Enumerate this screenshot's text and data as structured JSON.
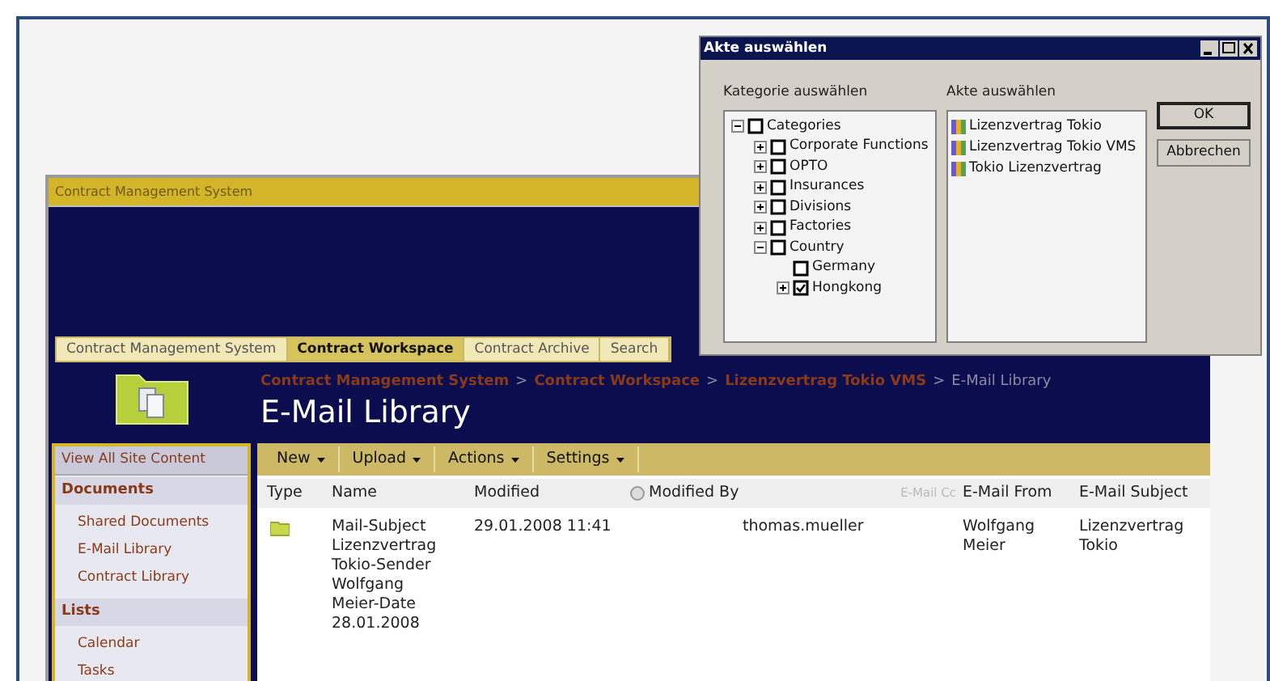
{
  "window": {
    "title": "Contract Management System"
  },
  "top_nav": [
    {
      "label": "Contract Management System",
      "selected": false
    },
    {
      "label": "Contract Workspace",
      "selected": true
    },
    {
      "label": "Contract Archive",
      "selected": false
    },
    {
      "label": "Search",
      "selected": false
    }
  ],
  "breadcrumb": {
    "separator": ">",
    "items": [
      "Contract Management System",
      "Contract Workspace",
      "Lizenzvertrag Tokio VMS",
      "E-Mail Library"
    ]
  },
  "page_title": "E-Mail Library",
  "quick_launch": {
    "view_all": "View All Site Content",
    "sections": [
      {
        "heading": "Documents",
        "items": [
          "Shared Documents",
          "E-Mail Library",
          "Contract Library"
        ]
      },
      {
        "heading": "Lists",
        "items": [
          "Calendar",
          "Tasks"
        ]
      }
    ]
  },
  "toolbar": [
    {
      "label": "New"
    },
    {
      "label": "Upload"
    },
    {
      "label": "Actions"
    },
    {
      "label": "Settings"
    }
  ],
  "table": {
    "columns": [
      {
        "label": "Type"
      },
      {
        "label": "Name"
      },
      {
        "label": "Modified"
      },
      {
        "label": "Modified By",
        "kind": "presence"
      },
      {
        "label": "E-Mail Cc",
        "dimmed": true
      },
      {
        "label": "E-Mail From"
      },
      {
        "label": "E-Mail Subject"
      }
    ],
    "rows": [
      {
        "kind": "folder",
        "name": "Mail-Subject Lizenzvertrag Tokio-Sender Wolfgang Meier-Date 28.01.2008",
        "modified": "29.01.2008 11:41",
        "modified_by": "thomas.mueller",
        "email_from": "Wolfgang Meier",
        "email_subject": "Lizenzvertrag Tokio"
      }
    ]
  },
  "dialog": {
    "title": "Akte auswählen",
    "category_label": "Kategorie auswählen",
    "file_label": "Akte auswählen",
    "tree": [
      {
        "label": "Categories",
        "expanded": true,
        "checked": false,
        "children": [
          {
            "label": "Corporate Functions",
            "expanded": false,
            "checked": false
          },
          {
            "label": "OPTO",
            "expanded": false,
            "checked": false
          },
          {
            "label": "Insurances",
            "expanded": false,
            "checked": false
          },
          {
            "label": "Divisions",
            "expanded": false,
            "checked": false
          },
          {
            "label": "Factories",
            "expanded": false,
            "checked": false
          },
          {
            "label": "Country",
            "expanded": true,
            "checked": false,
            "children": [
              {
                "label": "Germany",
                "checked": false
              },
              {
                "label": "Hongkong",
                "expanded": false,
                "checked": true
              }
            ]
          }
        ]
      }
    ],
    "files": [
      "Lizenzvertrag Tokio",
      "Lizenzvertrag Tokio VMS",
      "Tokio Lizenzvertrag"
    ],
    "buttons": [
      {
        "label": "OK",
        "default": true
      },
      {
        "label": "Abbrechen",
        "default": false
      }
    ]
  }
}
